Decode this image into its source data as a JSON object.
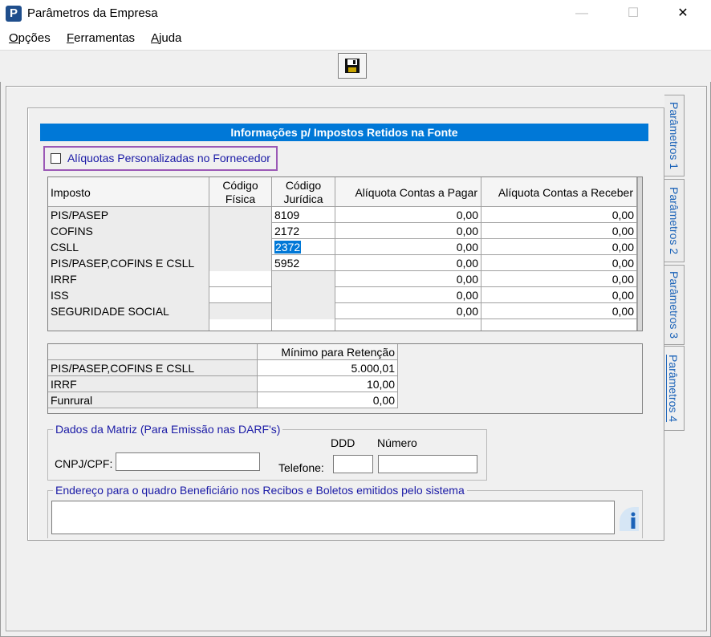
{
  "window": {
    "title": "Parâmetros da Empresa",
    "logo_letter": "P",
    "minimize": "—",
    "maximize": "☐",
    "close": "✕"
  },
  "menu": [
    {
      "first": "O",
      "rest": "pções"
    },
    {
      "first": "F",
      "rest": "erramentas"
    },
    {
      "first": "A",
      "rest": "juda"
    }
  ],
  "tabs": [
    "Parâmetros 1",
    "Parâmetros 2",
    "Parâmetros 3",
    "Parâmetros 4"
  ],
  "section": {
    "title": "Informações p/ Impostos Retidos na Fonte",
    "checkbox_label": "Alíquotas Personalizadas no Fornecedor",
    "checkbox_checked": false
  },
  "grid": {
    "headers": {
      "imposto": "Imposto",
      "cod_fisica_1": "Código",
      "cod_fisica_2": "Física",
      "cod_juridica_1": "Código",
      "cod_juridica_2": "Jurídica",
      "aliq_pagar": "Alíquota Contas a Pagar",
      "aliq_receber": "Alíquota Contas a Receber"
    },
    "rows": [
      {
        "imposto": "PIS/PASEP",
        "fisica": "",
        "juridica": "8109",
        "pagar": "0,00",
        "receber": "0,00"
      },
      {
        "imposto": "COFINS",
        "fisica": "",
        "juridica": "2172",
        "pagar": "0,00",
        "receber": "0,00"
      },
      {
        "imposto": "CSLL",
        "fisica": "",
        "juridica": "2372",
        "pagar": "0,00",
        "receber": "0,00"
      },
      {
        "imposto": "PIS/PASEP,COFINS E CSLL",
        "fisica": "",
        "juridica": "5952",
        "pagar": "0,00",
        "receber": "0,00"
      },
      {
        "imposto": "IRRF",
        "fisica": "",
        "juridica": "",
        "pagar": "0,00",
        "receber": "0,00"
      },
      {
        "imposto": "ISS",
        "fisica": "",
        "juridica": "",
        "pagar": "0,00",
        "receber": "0,00"
      },
      {
        "imposto": "SEGURIDADE SOCIAL",
        "fisica": "",
        "juridica": "",
        "pagar": "0,00",
        "receber": "0,00"
      }
    ]
  },
  "minimum": {
    "header": "Mínimo para Retenção",
    "rows": [
      {
        "label": "PIS/PASEP,COFINS E CSLL",
        "value": "5.000,01"
      },
      {
        "label": "IRRF",
        "value": "10,00"
      },
      {
        "label": "Funrural",
        "value": "0,00"
      }
    ]
  },
  "matriz": {
    "legend": "Dados da Matriz (Para Emissão nas DARF's)",
    "cnpj_label": "CNPJ/CPF:",
    "cnpj_value": "",
    "ddd_label": "DDD",
    "numero_label": "Número",
    "telefone_label": "Telefone:",
    "ddd_value": "",
    "numero_value": ""
  },
  "endereco": {
    "legend": "Endereço para o quadro Beneficiário nos Recibos e Boletos emitidos pelo sistema",
    "value": ""
  }
}
